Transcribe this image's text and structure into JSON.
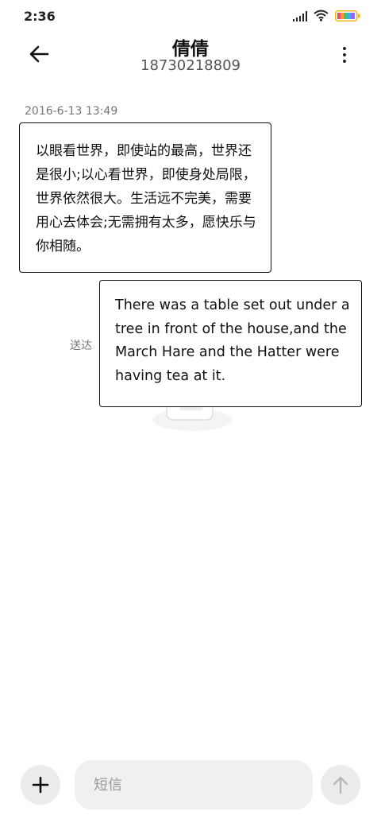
{
  "status_bar": {
    "time": "2:36",
    "icons": [
      "signal-icon",
      "wifi-icon",
      "battery-icon"
    ]
  },
  "header": {
    "back_icon": "arrow-left-icon",
    "contact_name": "倩倩",
    "phone_number": "18730218809",
    "more_icon": "more-vertical-icon"
  },
  "conversation": {
    "timestamp": "2016-6-13 13:49",
    "received_message": "以眼看世界，即使站的最高，世界还是很小;以心看世界，即使身处局限，世界依然很大。生活远不完美，需要用心去体会;无需拥有太多，愿快乐与你相随。",
    "delivery_status": "送达",
    "sent_message": "There was a table set out under a tree in front of the house,and the March Hare and the Hatter were having tea at it."
  },
  "composer": {
    "add_icon": "plus-icon",
    "placeholder": "短信",
    "value": "",
    "send_icon": "arrow-up-icon"
  },
  "colors": {
    "background": "#ffffff",
    "button_bg": "#ececec",
    "input_bg": "#f0f0f0",
    "secondary_text": "#777777"
  }
}
